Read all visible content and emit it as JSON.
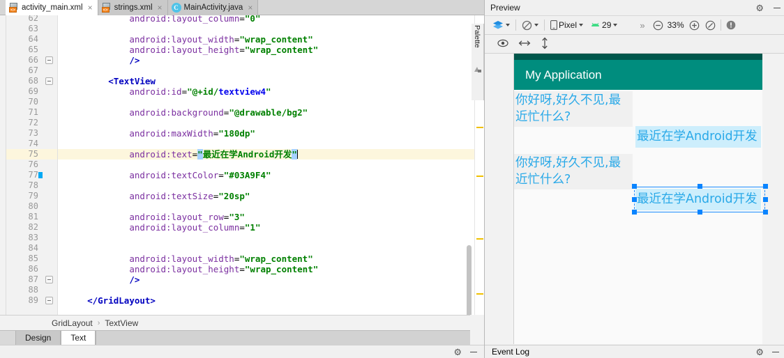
{
  "editor": {
    "tabs": [
      {
        "label": "activity_main.xml",
        "icon": "xml-layout-icon",
        "active": true,
        "close": "×"
      },
      {
        "label": "strings.xml",
        "icon": "xml-layout-icon",
        "active": false,
        "close": "×"
      },
      {
        "label": "MainActivity.java",
        "icon": "java-class-icon",
        "active": false,
        "close": "×"
      }
    ],
    "first_visible_line": 62,
    "highlighted_line": 75,
    "color_swatch_line": 77,
    "color_swatch_hex": "#03A9F4",
    "fold_lines": [
      66,
      68,
      87,
      89
    ],
    "lines": [
      {
        "n": 62,
        "clipped": true,
        "tokens": [
          {
            "t": "            ",
            "c": "k-plain"
          },
          {
            "t": "android:layout_column",
            "c": "k-attr"
          },
          {
            "t": "=",
            "c": "k-punct"
          },
          {
            "t": "\"0\"",
            "c": "k-val"
          }
        ]
      },
      {
        "n": 63,
        "tokens": []
      },
      {
        "n": 64,
        "tokens": [
          {
            "t": "            ",
            "c": "k-plain"
          },
          {
            "t": "android:layout_width",
            "c": "k-attr"
          },
          {
            "t": "=",
            "c": "k-punct"
          },
          {
            "t": "\"wrap_content\"",
            "c": "k-val"
          }
        ]
      },
      {
        "n": 65,
        "tokens": [
          {
            "t": "            ",
            "c": "k-plain"
          },
          {
            "t": "android:layout_height",
            "c": "k-attr"
          },
          {
            "t": "=",
            "c": "k-punct"
          },
          {
            "t": "\"wrap_content\"",
            "c": "k-val"
          }
        ]
      },
      {
        "n": 66,
        "tokens": [
          {
            "t": "            ",
            "c": "k-plain"
          },
          {
            "t": "/>",
            "c": "k-tag"
          }
        ]
      },
      {
        "n": 67,
        "tokens": []
      },
      {
        "n": 68,
        "tokens": [
          {
            "t": "        ",
            "c": "k-plain"
          },
          {
            "t": "<TextView",
            "c": "k-tag"
          }
        ]
      },
      {
        "n": 69,
        "tokens": [
          {
            "t": "            ",
            "c": "k-plain"
          },
          {
            "t": "android:id",
            "c": "k-attr"
          },
          {
            "t": "=",
            "c": "k-punct"
          },
          {
            "t": "\"@+id/",
            "c": "k-val"
          },
          {
            "t": "textview4",
            "c": "k-ref"
          },
          {
            "t": "\"",
            "c": "k-val"
          }
        ]
      },
      {
        "n": 70,
        "tokens": []
      },
      {
        "n": 71,
        "tokens": [
          {
            "t": "            ",
            "c": "k-plain"
          },
          {
            "t": "android:background",
            "c": "k-attr"
          },
          {
            "t": "=",
            "c": "k-punct"
          },
          {
            "t": "\"@drawable/bg2\"",
            "c": "k-val"
          }
        ]
      },
      {
        "n": 72,
        "tokens": []
      },
      {
        "n": 73,
        "tokens": [
          {
            "t": "            ",
            "c": "k-plain"
          },
          {
            "t": "android:maxWidth",
            "c": "k-attr"
          },
          {
            "t": "=",
            "c": "k-punct"
          },
          {
            "t": "\"180dp\"",
            "c": "k-val"
          }
        ]
      },
      {
        "n": 74,
        "tokens": []
      },
      {
        "n": 75,
        "highlighted": true,
        "tokens": [
          {
            "t": "            ",
            "c": "k-plain"
          },
          {
            "t": "android:text",
            "c": "k-attr"
          },
          {
            "t": "=",
            "c": "k-punct"
          },
          {
            "t": "\"",
            "c": "k-val sel"
          },
          {
            "t": "最近在学Android开发",
            "c": "k-val"
          },
          {
            "t": "\"",
            "c": "k-val sel"
          },
          {
            "t": "",
            "c": "caret-after"
          }
        ]
      },
      {
        "n": 76,
        "tokens": []
      },
      {
        "n": 77,
        "tokens": [
          {
            "t": "            ",
            "c": "k-plain"
          },
          {
            "t": "android:textColor",
            "c": "k-attr"
          },
          {
            "t": "=",
            "c": "k-punct"
          },
          {
            "t": "\"#03A9F4\"",
            "c": "k-val"
          }
        ]
      },
      {
        "n": 78,
        "tokens": []
      },
      {
        "n": 79,
        "tokens": [
          {
            "t": "            ",
            "c": "k-plain"
          },
          {
            "t": "android:textSize",
            "c": "k-attr"
          },
          {
            "t": "=",
            "c": "k-punct"
          },
          {
            "t": "\"20sp\"",
            "c": "k-val"
          }
        ]
      },
      {
        "n": 80,
        "tokens": []
      },
      {
        "n": 81,
        "tokens": [
          {
            "t": "            ",
            "c": "k-plain"
          },
          {
            "t": "android:layout_row",
            "c": "k-attr"
          },
          {
            "t": "=",
            "c": "k-punct"
          },
          {
            "t": "\"3\"",
            "c": "k-val"
          }
        ]
      },
      {
        "n": 82,
        "tokens": [
          {
            "t": "            ",
            "c": "k-plain"
          },
          {
            "t": "android:layout_column",
            "c": "k-attr"
          },
          {
            "t": "=",
            "c": "k-punct"
          },
          {
            "t": "\"1\"",
            "c": "k-val"
          }
        ]
      },
      {
        "n": 83,
        "tokens": []
      },
      {
        "n": 84,
        "tokens": []
      },
      {
        "n": 85,
        "tokens": [
          {
            "t": "            ",
            "c": "k-plain"
          },
          {
            "t": "android:layout_width",
            "c": "k-attr"
          },
          {
            "t": "=",
            "c": "k-punct"
          },
          {
            "t": "\"wrap_content\"",
            "c": "k-val"
          }
        ]
      },
      {
        "n": 86,
        "tokens": [
          {
            "t": "            ",
            "c": "k-plain"
          },
          {
            "t": "android:layout_height",
            "c": "k-attr"
          },
          {
            "t": "=",
            "c": "k-punct"
          },
          {
            "t": "\"wrap_content\"",
            "c": "k-val"
          }
        ]
      },
      {
        "n": 87,
        "tokens": [
          {
            "t": "            ",
            "c": "k-plain"
          },
          {
            "t": "/>",
            "c": "k-tag"
          }
        ]
      },
      {
        "n": 88,
        "tokens": []
      },
      {
        "n": 89,
        "tokens": [
          {
            "t": "    ",
            "c": "k-plain"
          },
          {
            "t": "</GridLayout>",
            "c": "k-tag"
          }
        ]
      }
    ],
    "warning_markers": [
      33,
      48,
      93,
      160,
      230,
      320,
      399
    ],
    "breadcrumb": [
      "GridLayout",
      "TextView"
    ],
    "breadcrumb_separator": "›",
    "bottom_tabs": [
      {
        "label": "Design",
        "active": false
      },
      {
        "label": "Text",
        "active": true
      }
    ]
  },
  "preview": {
    "title": "Preview",
    "palette_label": "Palette",
    "toolbar": {
      "theme_label": "",
      "orientation_label": "",
      "device_label": "Pixel",
      "api_label": "29",
      "overflow": "»",
      "zoom_out": "−",
      "zoom_level": "33%",
      "zoom_in": "+",
      "zoom_fit": "fit-screen",
      "issues": "!"
    },
    "toolbar2": {
      "eye": "visibility-icon",
      "horizontal": "constrain-horizontal-icon",
      "vertical": "constrain-vertical-icon"
    },
    "device": {
      "app_title": "My Application",
      "appbar_color": "#008d7e",
      "statusbar_color": "#00564b",
      "text_color": "#2aa9e8",
      "messages": [
        {
          "text": "你好呀,好久不见,最近忙什么?",
          "side": "left",
          "selected": false
        },
        {
          "text": "最近在学Android开发",
          "side": "right",
          "selected": false
        },
        {
          "text": "你好呀,好久不见,最近忙什么?",
          "side": "left",
          "selected": false
        },
        {
          "text": "最近在学Android开发",
          "side": "right",
          "selected": true
        }
      ]
    }
  },
  "statusbar": {
    "event_log": "Event Log"
  }
}
